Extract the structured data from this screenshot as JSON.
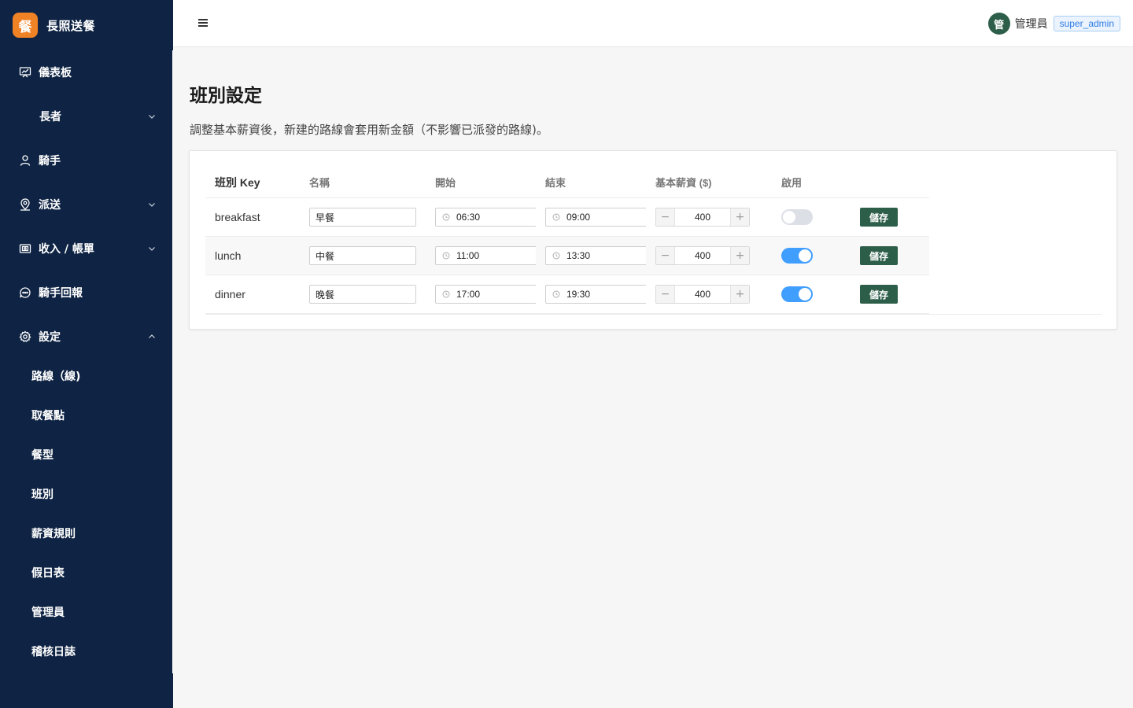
{
  "app": {
    "logo_char": "餐",
    "name": "長照送餐"
  },
  "sidebar": {
    "items": [
      {
        "label": "儀表板",
        "icon": "dashboard-icon"
      },
      {
        "label": "長者",
        "icon": "",
        "arrow": "chevron-down-icon"
      },
      {
        "label": "騎手",
        "icon": "user-icon"
      },
      {
        "label": "派送",
        "icon": "map-pin-icon",
        "arrow": "chevron-down-icon"
      },
      {
        "label": "收入 / 帳單",
        "icon": "wallet-icon",
        "arrow": "chevron-down-icon"
      },
      {
        "label": "騎手回報",
        "icon": "chat-icon"
      },
      {
        "label": "設定",
        "icon": "gear-icon",
        "arrow": "chevron-up-icon"
      }
    ],
    "submenu": [
      {
        "label": "路線（線)"
      },
      {
        "label": "取餐點"
      },
      {
        "label": "餐型"
      },
      {
        "label": "班別"
      },
      {
        "label": "薪資規則"
      },
      {
        "label": "假日表"
      },
      {
        "label": "管理員"
      },
      {
        "label": "稽核日誌"
      }
    ]
  },
  "header": {
    "avatar_char": "管",
    "user_name": "管理員",
    "role": "super_admin"
  },
  "page": {
    "title": "班別設定",
    "description": "調整基本薪資後，新建的路線會套用新金額（不影響已派發的路線)。"
  },
  "table": {
    "columns": [
      "班別 Key",
      "名稱",
      "開始",
      "結束",
      "基本薪資 ($)",
      "啟用"
    ],
    "rows": [
      {
        "key": "breakfast",
        "name": "早餐",
        "start": "06:30",
        "end": "09:00",
        "wage": "400",
        "enabled": false,
        "action": "儲存"
      },
      {
        "key": "lunch",
        "name": "中餐",
        "start": "11:00",
        "end": "13:30",
        "wage": "400",
        "enabled": true,
        "action": "儲存"
      },
      {
        "key": "dinner",
        "name": "晚餐",
        "start": "17:00",
        "end": "19:30",
        "wage": "400",
        "enabled": true,
        "action": "儲存"
      }
    ]
  },
  "colors": {
    "sidebar_bg": "#0f2444",
    "brand_orange": "#f08226",
    "primary_green": "#2d5e49",
    "toggle_on": "#409eff",
    "toggle_off": "#dcdfe6"
  }
}
